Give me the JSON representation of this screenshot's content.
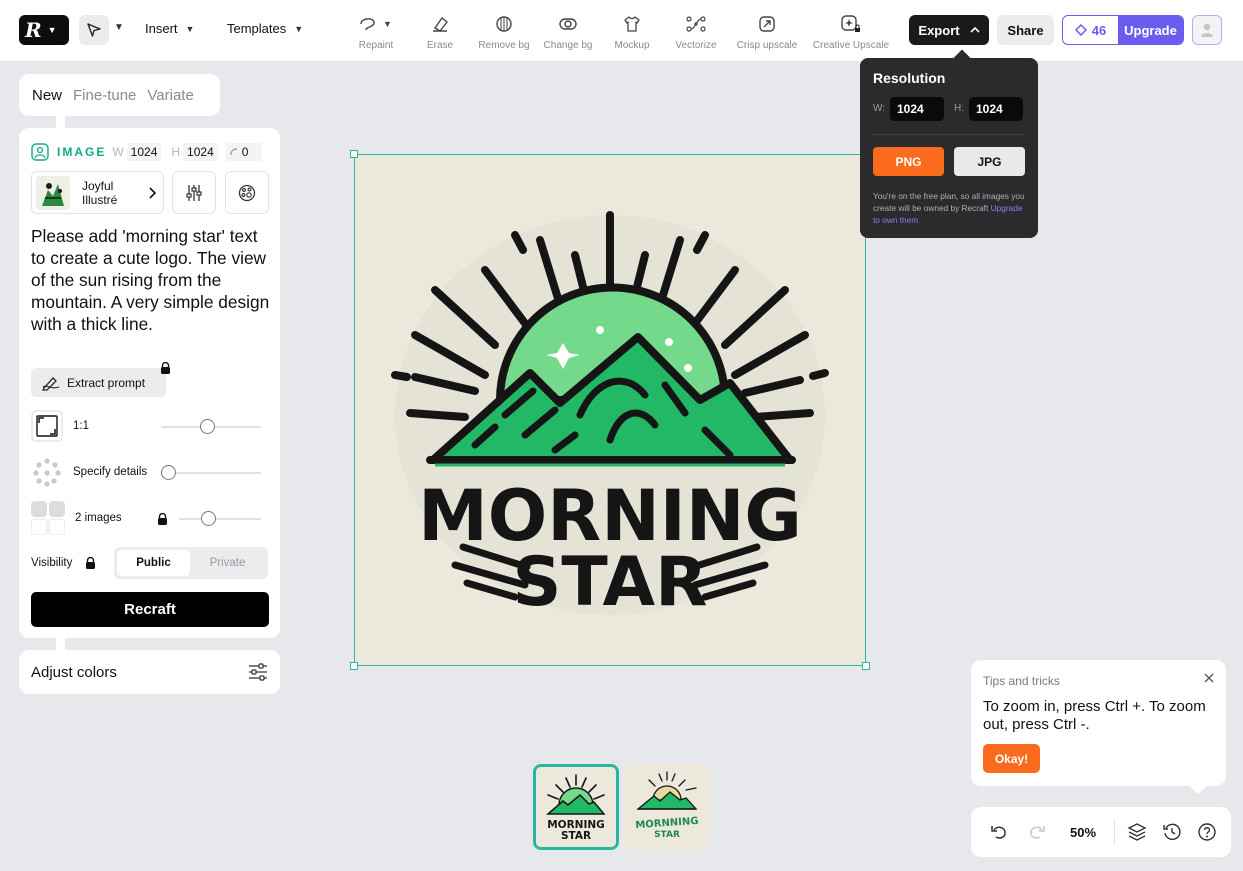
{
  "header": {
    "menus": [
      {
        "label": "Insert"
      },
      {
        "label": "Templates"
      }
    ],
    "tools": [
      {
        "label": "Repaint",
        "icon": "repaint-icon"
      },
      {
        "label": "Erase",
        "icon": "eraser-icon"
      },
      {
        "label": "Remove bg",
        "icon": "remove-bg-icon"
      },
      {
        "label": "Change bg",
        "icon": "change-bg-icon"
      },
      {
        "label": "Mockup",
        "icon": "tshirt-icon"
      },
      {
        "label": "Vectorize",
        "icon": "vectorize-icon"
      },
      {
        "label": "Crisp upscale",
        "icon": "upscale-icon"
      },
      {
        "label": "Creative Upscale",
        "icon": "creative-upscale-icon"
      }
    ],
    "export_label": "Export",
    "share_label": "Share",
    "credits": "46",
    "upgrade_label": "Upgrade"
  },
  "export_popup": {
    "title": "Resolution",
    "w_label": "W:",
    "w_value": "1024",
    "h_label": "H:",
    "h_value": "1024",
    "png_label": "PNG",
    "jpg_label": "JPG",
    "note": "You're on the free plan, so all images you create will be owned by Recraft ",
    "note_link": "Upgrade to own them"
  },
  "left_panel": {
    "tabs": [
      {
        "label": "New",
        "active": true
      },
      {
        "label": "Fine-tune",
        "active": false
      },
      {
        "label": "Variate",
        "active": false
      }
    ],
    "image_label": "IMAGE",
    "w_label": "W",
    "w_value": "1024",
    "h_label": "H",
    "h_value": "1024",
    "rotation_value": "0",
    "style_name": "Joyful Illustré",
    "prompt": "Please add 'morning star' text to create a cute logo. The view of the sun rising from the mountain. A very simple design with a thick line.",
    "extract_label": "Extract prompt",
    "aspect_label": "1:1",
    "details_label": "Specify details",
    "images_label": "2 images",
    "visibility_label": "Visibility",
    "public_label": "Public",
    "private_label": "Private",
    "recraft_label": "Recraft",
    "adjust_label": "Adjust colors"
  },
  "canvas": {
    "logo_line1": "MORNING",
    "logo_line2": "STAR"
  },
  "thumbnails": [
    {
      "line1": "MORNING",
      "line2": "STAR",
      "selected": true
    },
    {
      "line1": "MORNNING",
      "line2": "STAR",
      "selected": false
    }
  ],
  "tips": {
    "title": "Tips and tricks",
    "body": "To zoom in, press Ctrl +. To zoom out, press Ctrl -.",
    "ok_label": "Okay!"
  },
  "bottom_bar": {
    "zoom": "50%"
  },
  "colors": {
    "accent_purple": "#6b5cf0",
    "accent_orange": "#fa6b1e",
    "teal": "#2ab7a0",
    "logo_green": "#1fb86a"
  }
}
